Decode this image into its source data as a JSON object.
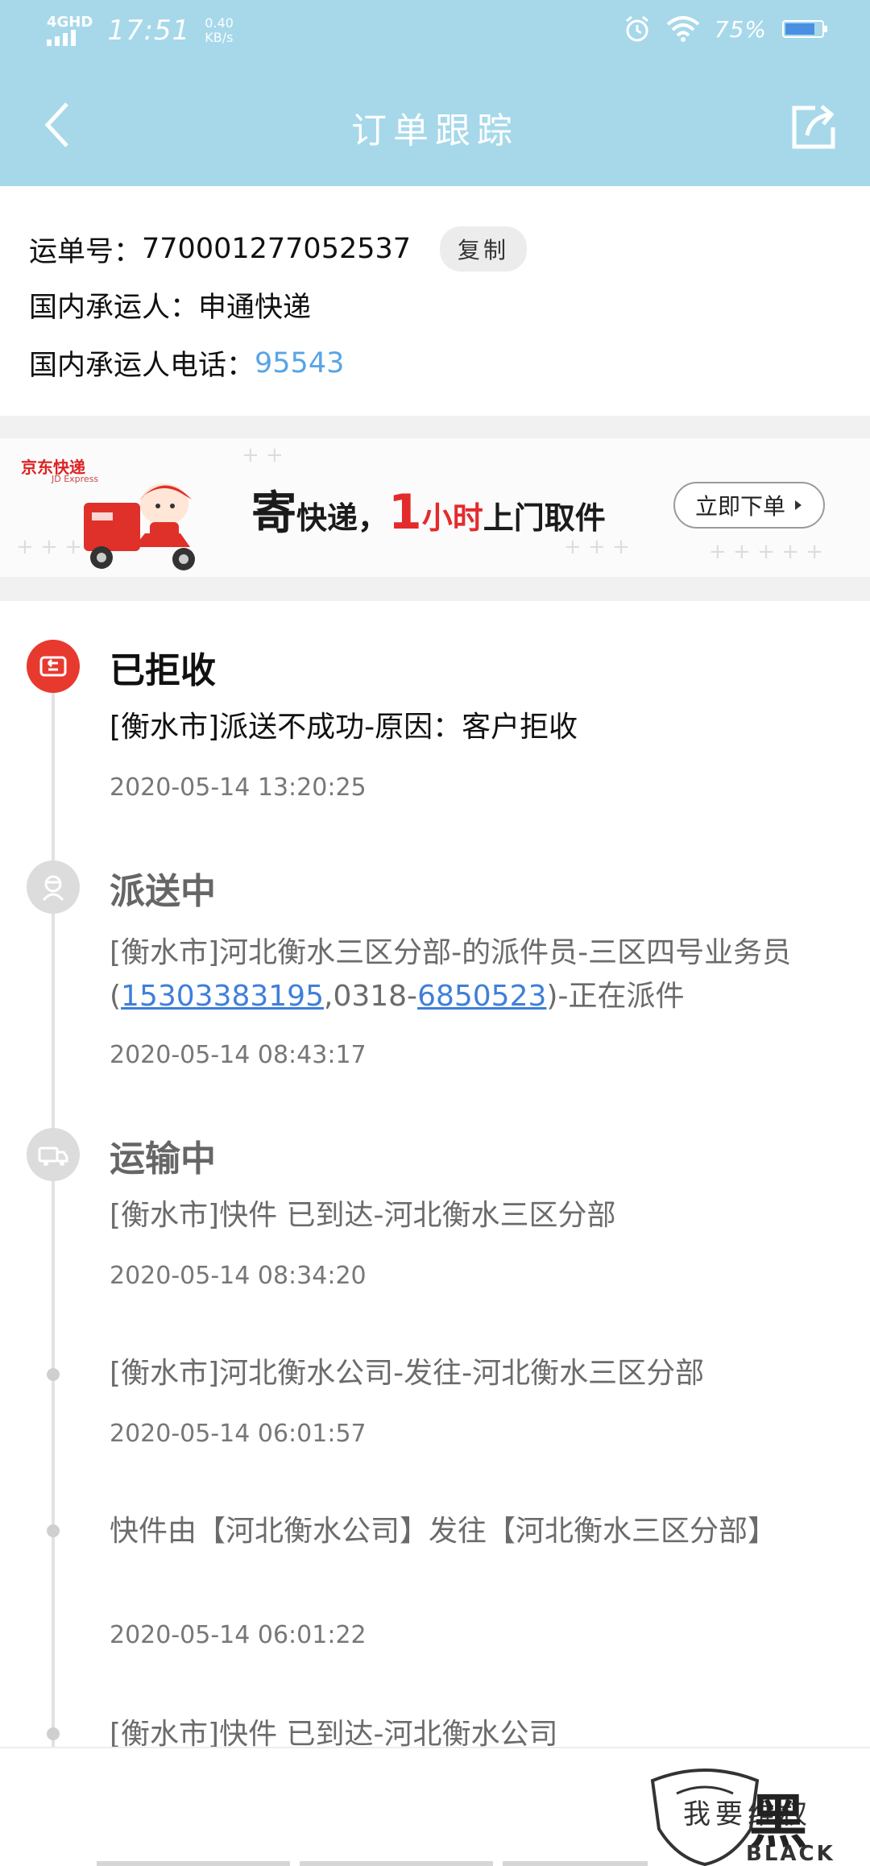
{
  "status_bar": {
    "network": "4GHD",
    "time": "17:51",
    "speed_value": "0.40",
    "speed_unit": "KB/s",
    "battery": "75%"
  },
  "header": {
    "title": "订单跟踪"
  },
  "waybill": {
    "number_label": "运单号：",
    "number": "770001277052537",
    "copy_label": "复制",
    "carrier_label": "国内承运人：",
    "carrier": "申通快递",
    "carrier_phone_label": "国内承运人电话：",
    "carrier_phone": "95543"
  },
  "banner": {
    "brand": "京东快递",
    "brand_en": "JD Express",
    "slogan_1": "寄",
    "slogan_2": "快递，",
    "slogan_3": "1",
    "slogan_4": "小时",
    "slogan_5": "上门取件",
    "button": "立即下单"
  },
  "timeline": {
    "events": [
      {
        "status": "已拒收",
        "desc": "[衡水市]派送不成功-原因：客户拒收",
        "time": "2020-05-14 13:20:25"
      },
      {
        "status": "派送中",
        "desc_part1": "[衡水市]河北衡水三区分部-的派件员-三区四号业务员(",
        "phone1": "15303383195",
        "desc_part2": ",0318-",
        "phone2": "6850523",
        "desc_part3": ")-正在派件",
        "time": "2020-05-14 08:43:17"
      },
      {
        "status": "运输中",
        "desc": "[衡水市]快件 已到达-河北衡水三区分部",
        "time": "2020-05-14 08:34:20"
      },
      {
        "desc": "[衡水市]河北衡水公司-发往-河北衡水三区分部",
        "time": "2020-05-14 06:01:57"
      },
      {
        "desc": "快件由【河北衡水公司】发往【河北衡水三区分部】",
        "time": "2020-05-14 06:01:22"
      },
      {
        "desc": "[衡水市]快件 已到达-河北衡水公司"
      }
    ]
  },
  "watermark": {
    "handwritten": "我要维权",
    "brand_cn": "黑猫",
    "brand_en": "BLACK CAT"
  }
}
